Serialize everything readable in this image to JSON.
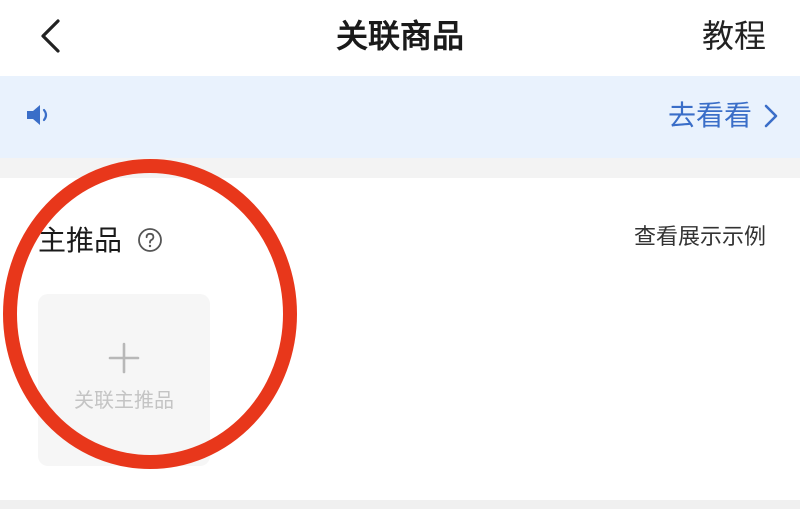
{
  "header": {
    "title": "关联商品",
    "tutorial_label": "教程",
    "back_icon": "chevron-left-icon"
  },
  "notice": {
    "icon": "speaker-icon",
    "text": "",
    "goto_label": "去看看",
    "goto_icon": "chevron-right-icon",
    "accent_color": "#3a6ec8",
    "background": "#e9f2fd"
  },
  "main_product": {
    "section_title": "主推品",
    "help_icon": "question-circle-icon",
    "example_label": "查看展示示例",
    "add_tile": {
      "icon": "plus-icon",
      "label": "关联主推品"
    }
  },
  "annotation": {
    "shape": "circle",
    "color": "#e8371b"
  }
}
